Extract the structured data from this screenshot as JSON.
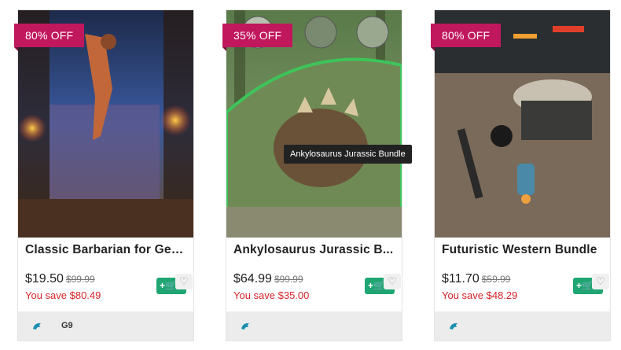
{
  "products": [
    {
      "discount": "80% OFF",
      "title": "Classic Barbarian for Gen...",
      "price": "$19.50",
      "old_price": "$99.99",
      "savings": "You save $80.49",
      "tag": "G9"
    },
    {
      "discount": "35% OFF",
      "title": "Ankylosaurus Jurassic B...",
      "price": "$64.99",
      "old_price": "$99.99",
      "savings": "You save $35.00",
      "tag": ""
    },
    {
      "discount": "80% OFF",
      "title": "Futuristic Western Bundle",
      "price": "$11.70",
      "old_price": "$59.99",
      "savings": "You save $48.29",
      "tag": ""
    }
  ],
  "tooltip": "Ankylosaurus Jurassic Bundle",
  "icons": {
    "cart": "add-to-cart-icon",
    "wishlist": "heart-icon",
    "brand": "daz-dragon-icon"
  },
  "colors": {
    "badge": "#c0175d",
    "cart_button": "#1fa672",
    "savings_text": "#d3262b"
  }
}
